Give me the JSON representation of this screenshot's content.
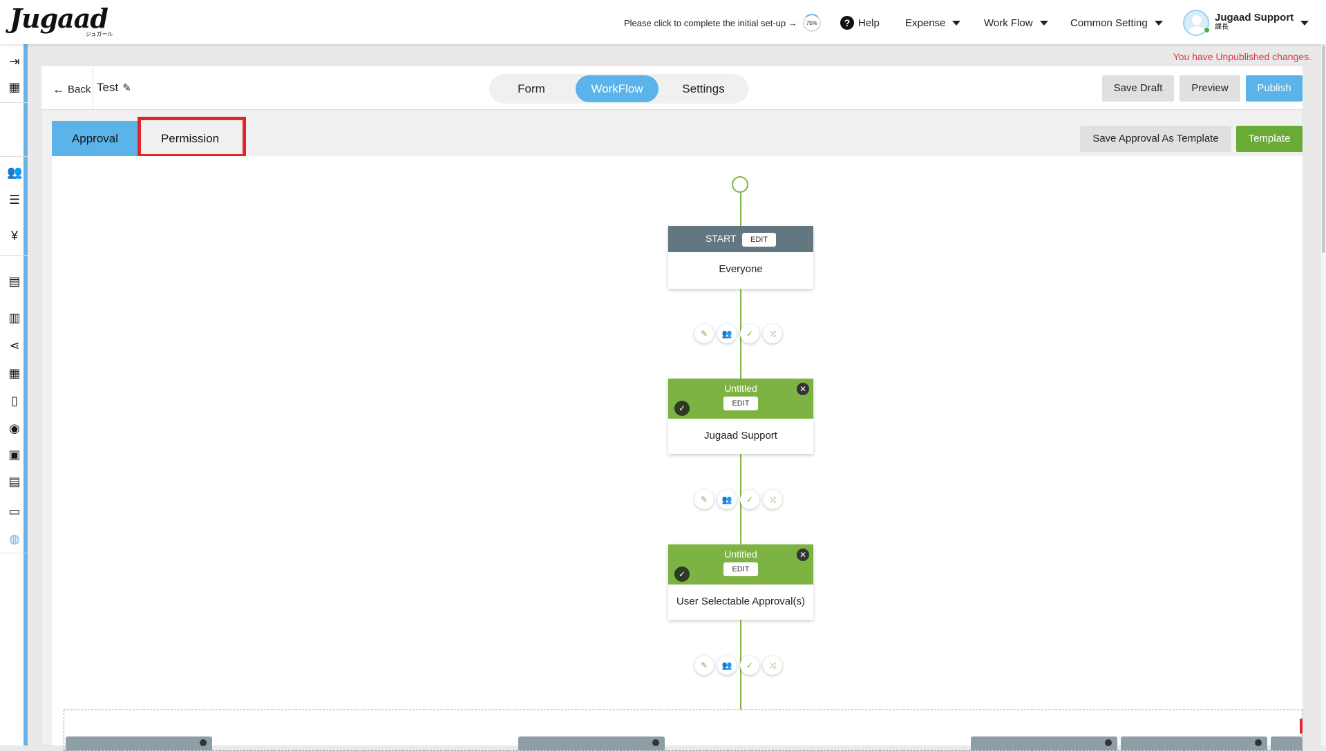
{
  "header": {
    "logo": "Jugaad",
    "logo_sub": "ジュガール",
    "setup_text": "Please click to complete the initial set-up →",
    "setup_pct": "75%",
    "help": "Help",
    "nav": [
      "Expense",
      "Work Flow",
      "Common Setting"
    ],
    "user_name": "Jugaad Support",
    "user_role": "課長"
  },
  "unpublished": "You have Unpublished changes.",
  "editor": {
    "back": "Back",
    "title": "Test",
    "segments": [
      "Form",
      "WorkFlow",
      "Settings"
    ],
    "active_segment": "WorkFlow",
    "save_draft": "Save Draft",
    "preview": "Preview",
    "publish": "Publish"
  },
  "tabs": {
    "approval": "Approval",
    "permission": "Permission",
    "save_template": "Save Approval As Template",
    "template": "Template"
  },
  "flow": {
    "start_label": "START",
    "edit": "EDIT",
    "start_body": "Everyone",
    "node1_title": "Untitled",
    "node1_body": "Jugaad Support",
    "node2_title": "Untitled",
    "node2_body": "User Selectable Approval(s)"
  },
  "colors": {
    "accent": "#5ab3e9",
    "green": "#7cb342",
    "highlight": "#e0262b",
    "warning_text": "#d9363e"
  },
  "icons": {
    "actions": [
      "pencil-icon",
      "add-user-icon",
      "check-icon",
      "branch-icon"
    ]
  }
}
